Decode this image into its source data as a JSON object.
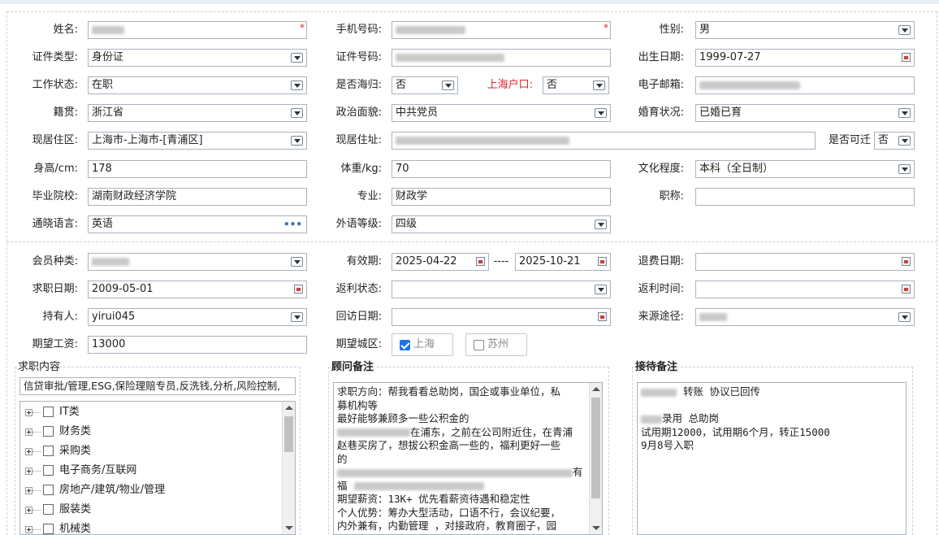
{
  "form": {
    "name_label": "姓名:",
    "phone_label": "手机号码:",
    "gender_label": "性别:",
    "gender_value": "男",
    "id_type_label": "证件类型:",
    "id_type_value": "身份证",
    "id_no_label": "证件号码:",
    "birth_label": "出生日期:",
    "birth_value": "1999-07-27",
    "work_status_label": "工作状态:",
    "work_status_value": "在职",
    "returnee_label": "是否海归:",
    "returnee_value": "否",
    "hukou_label": "上海户口:",
    "hukou_value": "否",
    "email_label": "电子邮箱:",
    "native_label": "籍贯:",
    "native_value": "浙江省",
    "political_label": "政治面貌:",
    "political_value": "中共党员",
    "marital_label": "婚育状况:",
    "marital_value": "已婚已育",
    "residence_area_label": "现居住区:",
    "residence_area_value": "上海市-上海市-[青浦区]",
    "address_label": "现居住址:",
    "relocate_label": "是否可迁",
    "relocate_value": "否",
    "height_label": "身高/cm:",
    "height_value": "178",
    "weight_label": "体重/kg:",
    "weight_value": "70",
    "education_label": "文化程度:",
    "education_value": "本科（全日制）",
    "school_label": "毕业院校:",
    "school_value": "湖南财政经济学院",
    "major_label": "专业:",
    "major_value": "财政学",
    "title_label": "职称:",
    "language_label": "通晓语言:",
    "language_value": "英语",
    "language_more": "•••",
    "lang_level_label": "外语等级:",
    "lang_level_value": "四级"
  },
  "membership": {
    "member_type_label": "会员种类:",
    "validity_label": "有效期:",
    "validity_start": "2025-04-22",
    "validity_sep": "----",
    "validity_end": "2025-10-21",
    "refund_date_label": "退费日期:",
    "job_date_label": "求职日期:",
    "job_date_value": "2009-05-01",
    "rebate_status_label": "返利状态:",
    "rebate_time_label": "返利时间:",
    "holder_label": "持有人:",
    "holder_value": "yirui045",
    "visit_date_label": "回访日期:",
    "source_label": "来源途径:",
    "salary_label": "期望工资:",
    "salary_value": "13000",
    "city_label": "期望城区:",
    "city_options": [
      "上海",
      "苏州"
    ]
  },
  "panels": {
    "job_title": "求职内容",
    "job_tags": "信贷审批/管理,ESG,保险理赔专员,反洗钱,分析,风险控制,",
    "tree_items": [
      "IT类",
      "财务类",
      "采购类",
      "电子商务/互联网",
      "房地产/建筑/物业/管理",
      "服装类",
      "机械类"
    ],
    "advisor_title": "顾问备注",
    "advisor_lines": [
      "求职方向：帮我看看总助岗，国企或事业单位，私",
      "募机构等",
      "最好能够兼顾多一些公积金的",
      "在浦东，之前在公司附近住，在青浦",
      "赵巷买房了，想拔公积金高一些的，福利更好一些",
      "的",
      "有",
      "福",
      "期望薪资：13K+  优先看薪资待遇和稳定性",
      "个人优势：筹办大型活动，口语不行，会议纪要，",
      "内外兼有，内勤管理 ，对接政府，教育圈子，园"
    ],
    "reception_title": "接待备注",
    "reception_lines": [
      "转账 协议已回传",
      "",
      "录用 总助岗",
      "试用期12000，试用期6个月，转正15000",
      "9月8号入职"
    ]
  }
}
